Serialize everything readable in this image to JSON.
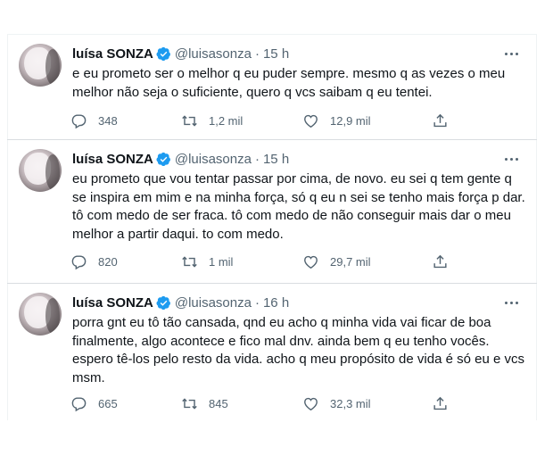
{
  "tweets": [
    {
      "author": {
        "name": "luísa SONZA",
        "handle": "@luisasonza"
      },
      "time": "15 h",
      "text": "e eu prometo ser o melhor q eu puder sempre. mesmo q as vezes o meu\nmelhor não seja o suficiente, quero q vcs saibam q eu tentei.",
      "replies": "348",
      "retweets": "1,2 mil",
      "likes": "12,9 mil"
    },
    {
      "author": {
        "name": "luísa SONZA",
        "handle": "@luisasonza"
      },
      "time": "15 h",
      "text": "eu prometo que vou tentar passar por cima, de novo. eu sei q tem gente q\nse inspira em mim e na minha força, só q eu n sei se tenho mais força p dar.\ntô com medo de ser fraca. tô com medo de não conseguir mais dar o meu\nmelhor a partir daqui. to com medo.",
      "replies": "820",
      "retweets": "1 mil",
      "likes": "29,7 mil"
    },
    {
      "author": {
        "name": "luísa SONZA",
        "handle": "@luisasonza"
      },
      "time": "16 h",
      "text": "porra gnt eu tô tão cansada, qnd eu acho q minha vida vai ficar de boa\nfinalmente, algo acontece e fico mal dnv.  ainda bem q eu tenho vocês.\nespero tê-los pelo resto da vida. acho q meu propósito de vida é só eu e vcs\nmsm.",
      "replies": "665",
      "retweets": "845",
      "likes": "32,3 mil"
    }
  ],
  "separator_dot": "·",
  "icons": {
    "verified": "verified-badge-icon",
    "more": "more-icon",
    "reply": "reply-icon",
    "retweet": "retweet-icon",
    "like": "like-icon",
    "share": "share-icon"
  },
  "colors": {
    "verified": "#1d9bf0",
    "muted": "#536471",
    "text": "#0f1419",
    "border": "#eff3f4"
  }
}
